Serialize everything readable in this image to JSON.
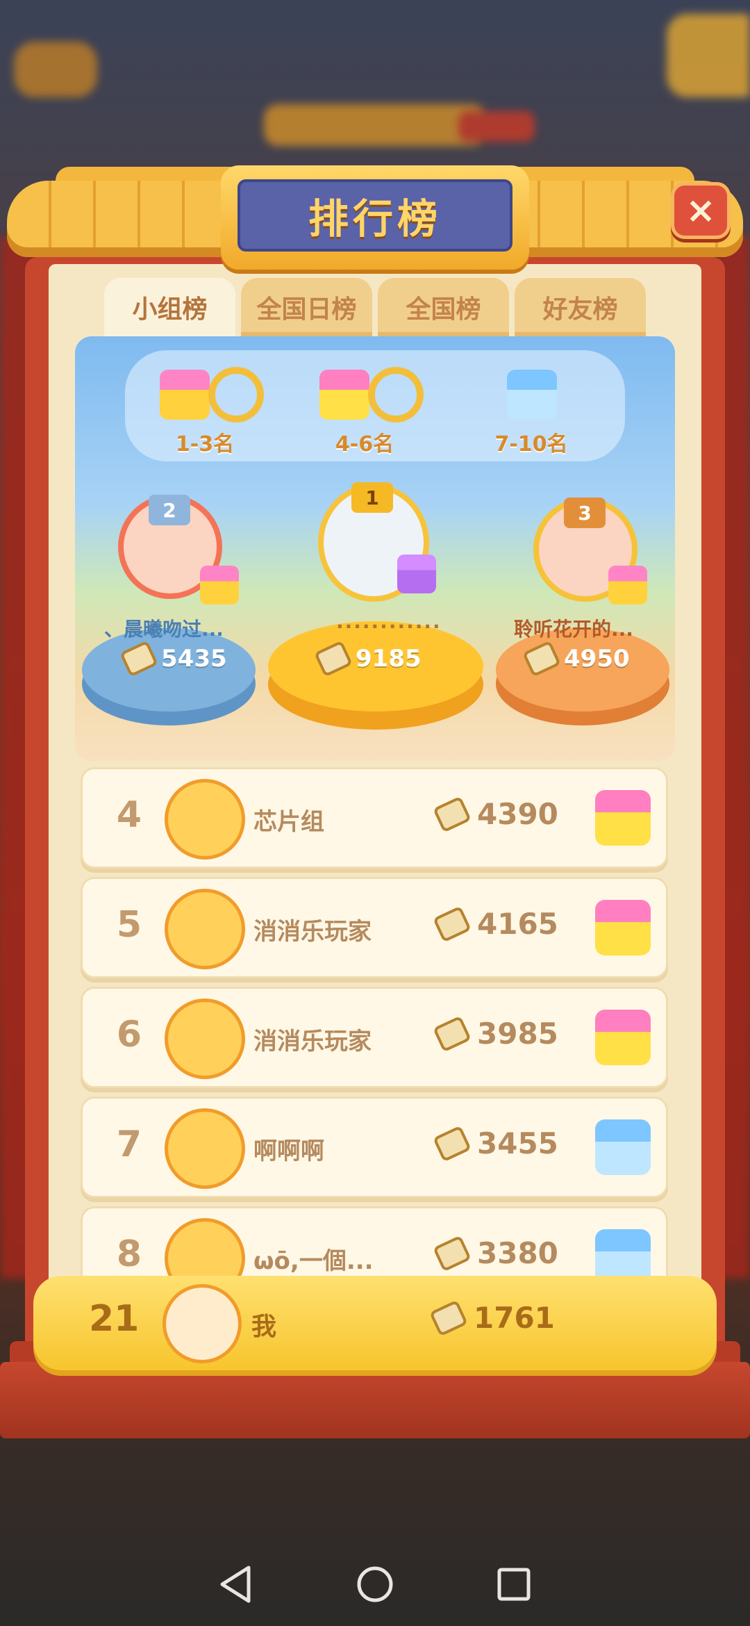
{
  "title": "排行榜",
  "close_label": "×",
  "tabs": [
    {
      "label": "小组榜",
      "active": true
    },
    {
      "label": "全国日榜",
      "active": false
    },
    {
      "label": "全国榜",
      "active": false
    },
    {
      "label": "好友榜",
      "active": false
    }
  ],
  "rewards": [
    {
      "label": "1-3名",
      "icon": "pink-gift-icon"
    },
    {
      "label": "4-6名",
      "icon": "yellow-gift-icon"
    },
    {
      "label": "7-10名",
      "icon": "blue-gift-icon"
    }
  ],
  "podium": [
    {
      "rank": "2",
      "name": "、晨曦吻过...",
      "score": "5435"
    },
    {
      "rank": "1",
      "name": "............",
      "score": "9185"
    },
    {
      "rank": "3",
      "name": "聆听花开的...",
      "score": "4950"
    }
  ],
  "rows": [
    {
      "rank": "4",
      "name": "芯片组",
      "score": "4390",
      "gift": "yellow"
    },
    {
      "rank": "5",
      "name": "消消乐玩家",
      "score": "4165",
      "gift": "yellow"
    },
    {
      "rank": "6",
      "name": "消消乐玩家",
      "score": "3985",
      "gift": "yellow"
    },
    {
      "rank": "7",
      "name": "啊啊啊",
      "score": "3455",
      "gift": "blue"
    },
    {
      "rank": "8",
      "name": "ωō,一個...",
      "score": "3380",
      "gift": "blue"
    }
  ],
  "me": {
    "rank": "21",
    "name": "我",
    "score": "1761"
  },
  "colors": {
    "frame": "#c7472e",
    "gold": "#f7c52d",
    "plaque": "#5a62a8"
  }
}
